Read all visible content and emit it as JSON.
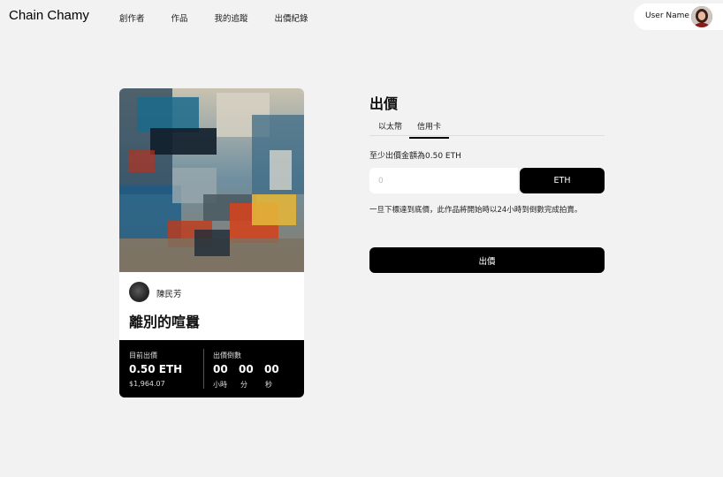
{
  "app": {
    "logo": "Chain Chamy"
  },
  "nav": {
    "items": [
      "創作者",
      "作品",
      "我的追蹤",
      "出價紀錄"
    ]
  },
  "user": {
    "name": "User Name"
  },
  "card": {
    "artist": "陳民芳",
    "title": "離別的喧囂",
    "current_bid_label": "目前出價",
    "current_bid": "0.50 ETH",
    "current_bid_usd": "$1,964.07",
    "countdown_label": "出價倒數",
    "countdown": {
      "hours": "00",
      "minutes": "00",
      "seconds": "00"
    },
    "units": {
      "hours": "小時",
      "minutes": "分",
      "seconds": "秒"
    }
  },
  "bid_panel": {
    "title": "出價",
    "tabs": [
      "以太幣",
      "信用卡"
    ],
    "active_tab": "信用卡",
    "min_bid_text": "至少出價金額為0.50 ETH",
    "input_placeholder": "0",
    "currency_label": "ETH",
    "notice": "一旦下標達到底價，此作品將開始時以24小時到倒數完成拍賣。",
    "submit_label": "出價"
  }
}
